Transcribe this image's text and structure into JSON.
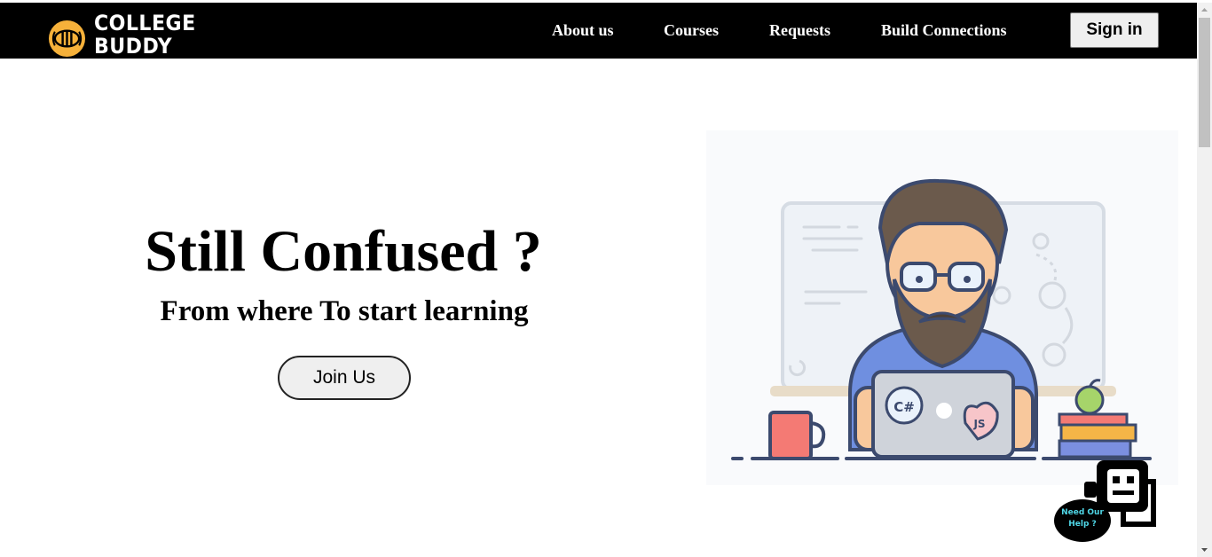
{
  "brand": {
    "name_line1": "COLLEGE",
    "name_line2": "BUDDY",
    "icon": "bee-icon",
    "badge_color": "#f6b13a"
  },
  "nav": {
    "links": [
      {
        "label": "About us"
      },
      {
        "label": "Courses"
      },
      {
        "label": "Requests"
      },
      {
        "label": "Build Connections"
      }
    ],
    "signin_label": "Sign in",
    "background": "#000000"
  },
  "hero": {
    "title": "Still Confused ?",
    "subtitle": "From where To start learning",
    "cta_label": "Join Us"
  },
  "illustration": {
    "laptop_badges": [
      "C#",
      "JS"
    ],
    "icon": "developer-illustration"
  },
  "chatbot": {
    "line1": "Need Our",
    "line2": "Help ?",
    "icon": "robot-icon",
    "text_color": "#4fd6e6"
  }
}
